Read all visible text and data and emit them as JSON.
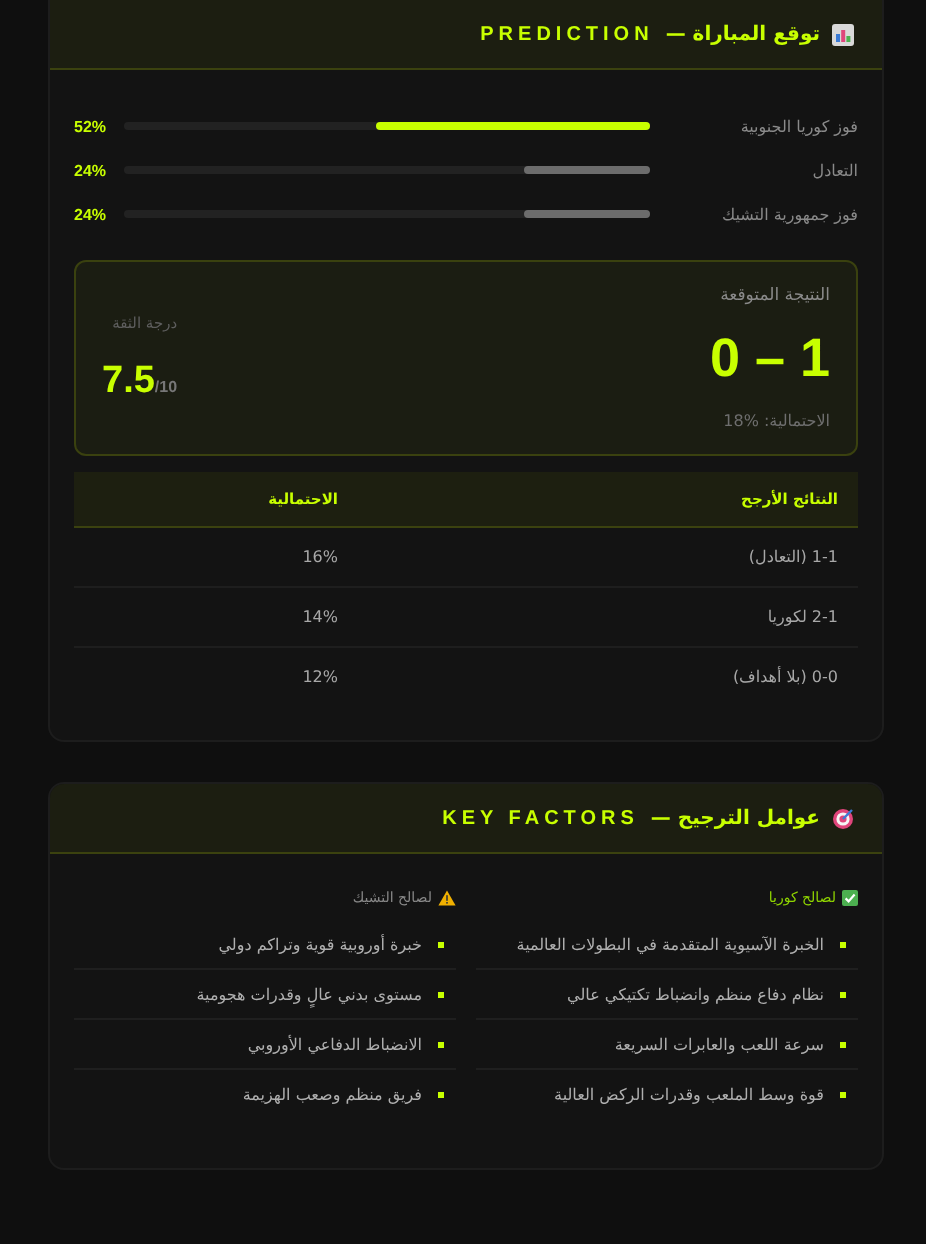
{
  "prediction": {
    "title": "توقع المباراة —",
    "title_en": "PREDICTION",
    "outcomes": [
      {
        "label": "فوز كوريا الجنوبية",
        "level": 0.52,
        "reading": "52%",
        "leading": true
      },
      {
        "label": "التعادل",
        "level": 0.24,
        "reading": "24%",
        "leading": false
      },
      {
        "label": "فوز جمهورية التشيك",
        "level": 0.24,
        "reading": "24%",
        "leading": false
      }
    ],
    "expected": {
      "label": "النتيجة المتوقعة",
      "score": "0 – 1",
      "probability": "الاحتمالية: %18",
      "confidence_label": "درجة الثقة",
      "confidence": "7.5",
      "confidence_max": "/10"
    },
    "table": {
      "columns": [
        "النتائج الأرجح",
        "الاحتمالية"
      ],
      "rows": [
        [
          "1-1 (التعادل)",
          "16%"
        ],
        [
          "2-1 لكوريا",
          "14%"
        ],
        [
          "0-0 (بلا أهداف)",
          "12%"
        ]
      ]
    }
  },
  "factors": {
    "title": "عوامل الترجيح —",
    "title_en": "KEY FACTORS",
    "columns": [
      {
        "kind": "pro",
        "heading": "لصالح كوريا",
        "items": [
          "الخبرة الآسيوية المتقدمة في البطولات العالمية",
          "نظام دفاع منظم وانضباط تكتيكي عالي",
          "سرعة اللعب والعابرات السريعة",
          "قوة وسط الملعب وقدرات الركض العالية"
        ]
      },
      {
        "kind": "con",
        "heading": "لصالح التشيك",
        "items": [
          "خبرة أوروبية قوية وتراكم دولي",
          "مستوى بدني عالٍ وقدرات هجومية",
          "الانضباط الدفاعي الأوروبي",
          "فريق منظم وصعب الهزيمة"
        ]
      }
    ]
  }
}
